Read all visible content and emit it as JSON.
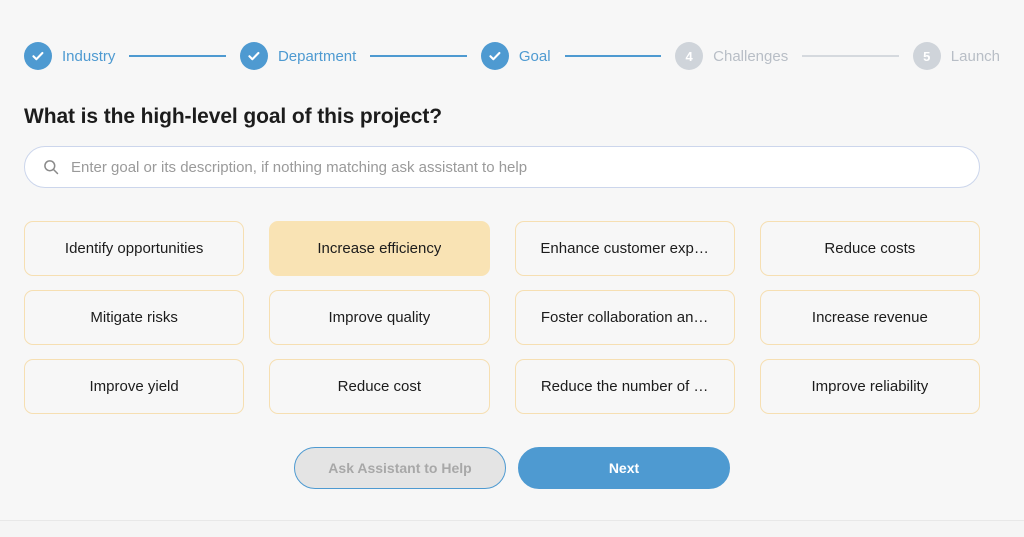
{
  "stepper": {
    "steps": [
      {
        "label": "Industry",
        "state": "done",
        "icon": "check-icon",
        "number": "1"
      },
      {
        "label": "Department",
        "state": "done",
        "icon": "check-icon",
        "number": "2"
      },
      {
        "label": "Goal",
        "state": "done",
        "icon": "check-icon",
        "number": "3"
      },
      {
        "label": "Challenges",
        "state": "todo",
        "icon": "",
        "number": "4"
      },
      {
        "label": "Launch",
        "state": "todo",
        "icon": "",
        "number": "5"
      }
    ],
    "connectors": [
      "done",
      "done",
      "done",
      "todo"
    ]
  },
  "heading": "What is the high-level goal of this project?",
  "search": {
    "icon": "search-icon",
    "value": "",
    "placeholder": "Enter goal or its description, if nothing matching ask assistant to help"
  },
  "options": [
    {
      "label": "Identify opportunities",
      "selected": false
    },
    {
      "label": "Increase efficiency",
      "selected": true
    },
    {
      "label": "Enhance customer exp…",
      "selected": false
    },
    {
      "label": "Reduce costs",
      "selected": false
    },
    {
      "label": "Mitigate risks",
      "selected": false
    },
    {
      "label": "Improve quality",
      "selected": false
    },
    {
      "label": "Foster collaboration an…",
      "selected": false
    },
    {
      "label": "Increase revenue",
      "selected": false
    },
    {
      "label": "Improve yield",
      "selected": false
    },
    {
      "label": "Reduce cost",
      "selected": false
    },
    {
      "label": "Reduce the number of …",
      "selected": false
    },
    {
      "label": "Improve reliability",
      "selected": false
    }
  ],
  "actions": {
    "assistant_label": "Ask Assistant to Help",
    "next_label": "Next"
  },
  "colors": {
    "accent_blue": "#4e9ad1",
    "selected_amber": "#f9e3b4",
    "card_border": "#f6dfb2",
    "inactive_gray": "#cfd4da",
    "page_bg": "#f7f7f7"
  }
}
